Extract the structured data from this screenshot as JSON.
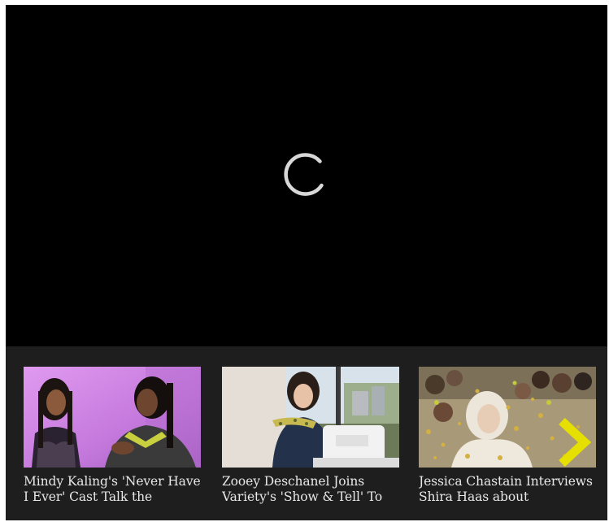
{
  "player": {
    "state": "loading"
  },
  "playlist": {
    "items": [
      {
        "title": "Mindy Kaling's 'Never Have I Ever' Cast Talk the"
      },
      {
        "title": "Zooey Deschanel Joins Variety's 'Show & Tell' To"
      },
      {
        "title": "Jessica Chastain Interviews Shira Haas about"
      }
    ],
    "next_icon": "chevron-right-icon",
    "accent_color": "#e6e000"
  }
}
